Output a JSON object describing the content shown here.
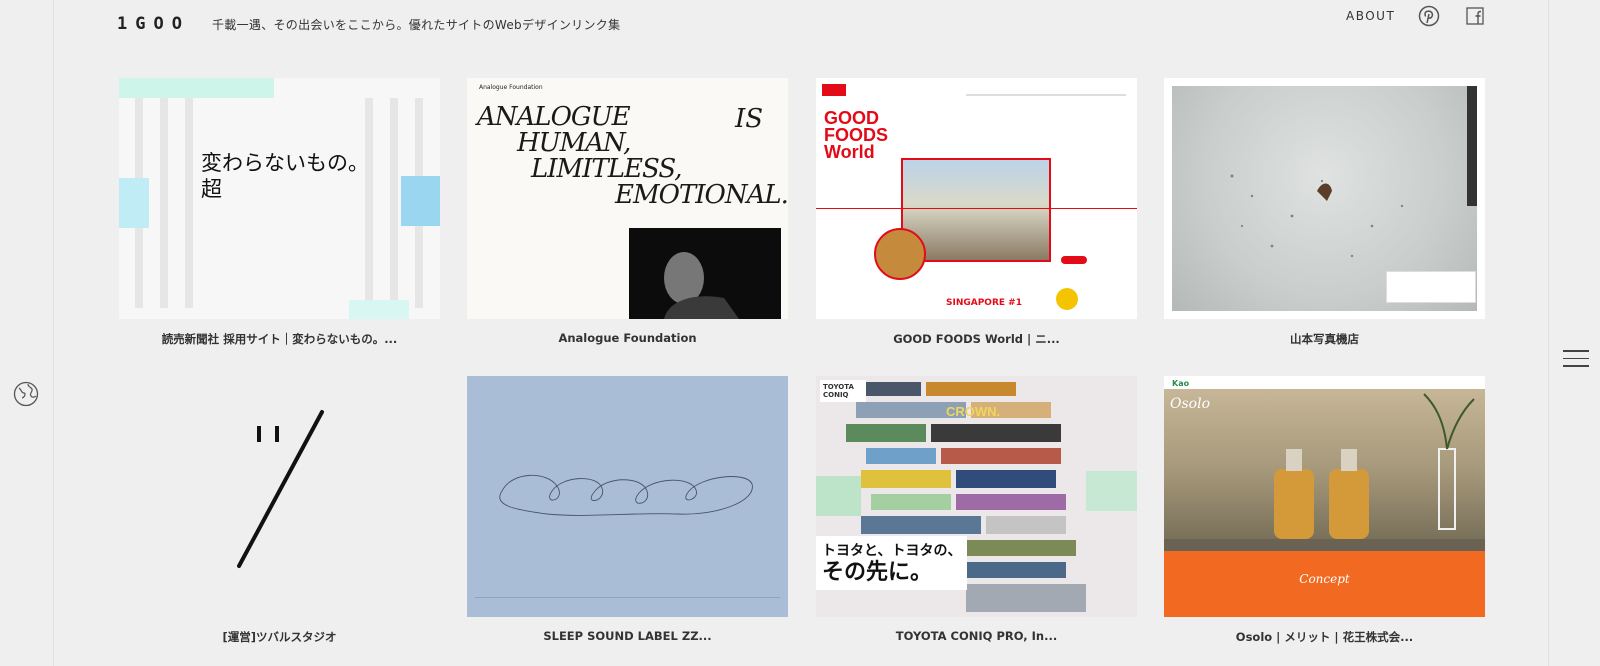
{
  "header": {
    "logo": "1GOO",
    "tagline": "千載一遇、その出会いをここから。優れたサイトのWebデザインリンク集",
    "about": "ABOUT",
    "icons": [
      "pinterest-icon",
      "facebook-icon"
    ]
  },
  "rail": {
    "icon": "globe-icon",
    "menu_icon": "hamburger-icon"
  },
  "cards": [
    {
      "title": "読売新聞社 採用サイト｜変わらないもの。...",
      "thumb_text": [
        "変わらないもの。",
        "超"
      ]
    },
    {
      "title": "Analogue Foundation",
      "thumb_brand": "Analogue Foundation",
      "thumb_lines": [
        "ANALOGUE",
        "IS",
        "HUMAN,",
        "LIMITLESS,",
        "EMOTIONAL."
      ]
    },
    {
      "title": "GOOD FOODS World | ニ...",
      "thumb_lines": [
        "GOOD",
        "FOODS",
        "World"
      ],
      "thumb_badge": "SINGAPORE #1"
    },
    {
      "title": "山本写真機店"
    },
    {
      "title": "[運営]ツバルスタジオ"
    },
    {
      "title": "SLEEP SOUND LABEL ZZ..."
    },
    {
      "title": "TOYOTA CONIQ PRO, In...",
      "thumb_brand": "TOYOTA CONIQ",
      "thumb_lines": [
        "トヨタと、トヨタの、",
        "その先に。"
      ],
      "thumb_word": "CROWN."
    },
    {
      "title": "Osolo | メリット | 花王株式会...",
      "thumb_brand": "Kao",
      "thumb_logo": "Osolo",
      "thumb_word": "Concept"
    }
  ],
  "colors": {
    "bg": "#efefef",
    "accent_red": "#e30b17",
    "orange": "#f26a21",
    "blue_gray": "#a9bdd6"
  }
}
